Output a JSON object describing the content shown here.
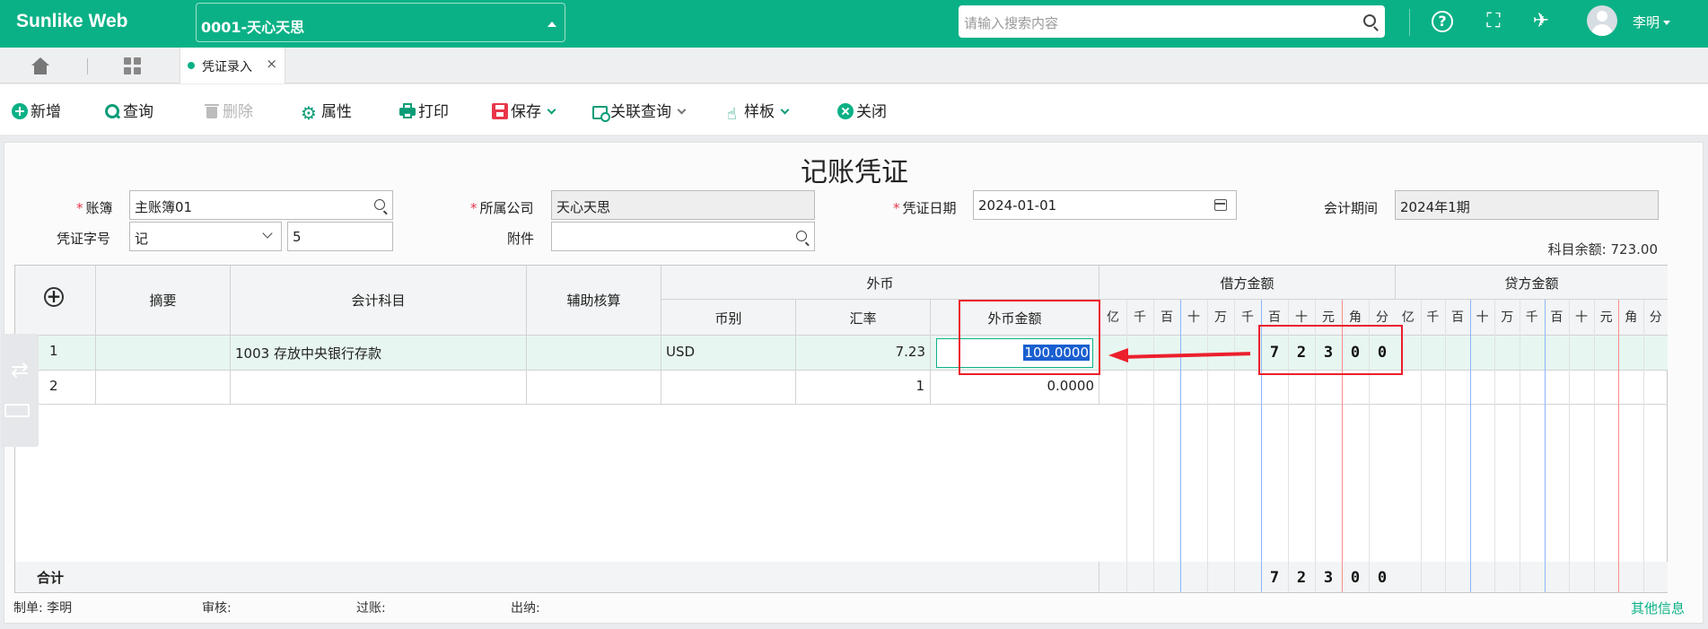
{
  "header": {
    "brand": "Sunlike Web",
    "company": "0001-天心天思",
    "search_placeholder": "请输入搜索内容",
    "username": "李明",
    "icons": [
      "help-icon",
      "fullscreen-icon",
      "broom-icon",
      "avatar"
    ]
  },
  "tabs": {
    "active_label": "凭证录入",
    "close_label": "×"
  },
  "toolbar": {
    "new_label": "新增",
    "query_label": "查询",
    "delete_label": "删除",
    "props_label": "属性",
    "print_label": "打印",
    "save_label": "保存",
    "related_label": "关联查询",
    "template_label": "样板",
    "close_label": "关闭"
  },
  "form": {
    "title": "记账凭证",
    "ledger_label": "账簿",
    "ledger_value": "主账簿01",
    "company_label": "所属公司",
    "company_value": "天心天思",
    "date_label": "凭证日期",
    "date_value": "2024-01-01",
    "period_label": "会计期间",
    "period_value": "2024年1期",
    "word_label": "凭证字号",
    "word_value": "记",
    "number_value": "5",
    "attach_label": "附件",
    "attach_value": "",
    "balance_label": "科目余额:",
    "balance_value": "723.00"
  },
  "grid": {
    "headers": {
      "add": "⊕",
      "summary": "摘要",
      "account": "会计科目",
      "aux": "辅助核算",
      "fc_group": "外币",
      "currency": "币别",
      "rate": "汇率",
      "fc_amount": "外币金额",
      "debit": "借方金额",
      "credit": "贷方金额"
    },
    "digit_labels": [
      "亿",
      "千",
      "百",
      "十",
      "万",
      "千",
      "百",
      "十",
      "元",
      "角",
      "分"
    ],
    "rows": [
      {
        "no": "1",
        "summary": "",
        "account": "1003 存放中央银行存款",
        "aux": "",
        "currency": "USD",
        "rate": "7.23",
        "fc_amount": "100.0000",
        "debit_digits": [
          "",
          "",
          "",
          "",
          "",
          "",
          "7",
          "2",
          "3",
          "0",
          "0"
        ]
      },
      {
        "no": "2",
        "summary": "",
        "account": "",
        "aux": "",
        "currency": "",
        "rate": "1",
        "fc_amount": "0.0000",
        "debit_digits": [
          "",
          "",
          "",
          "",
          "",
          "",
          "",
          "",
          "",
          "",
          ""
        ]
      }
    ],
    "total_label": "合计",
    "total_debit_digits": [
      "",
      "",
      "",
      "",
      "",
      "",
      "7",
      "2",
      "3",
      "0",
      "0"
    ]
  },
  "footer": {
    "maker_label": "制单:",
    "maker_value": "李明",
    "review_label": "审核:",
    "post_label": "过账:",
    "cashier_label": "出纳:",
    "other_info": "其他信息"
  },
  "colors": {
    "brand": "#0bb186",
    "highlight_box": "#ec1f2c",
    "selection": "#1a5fd0"
  }
}
